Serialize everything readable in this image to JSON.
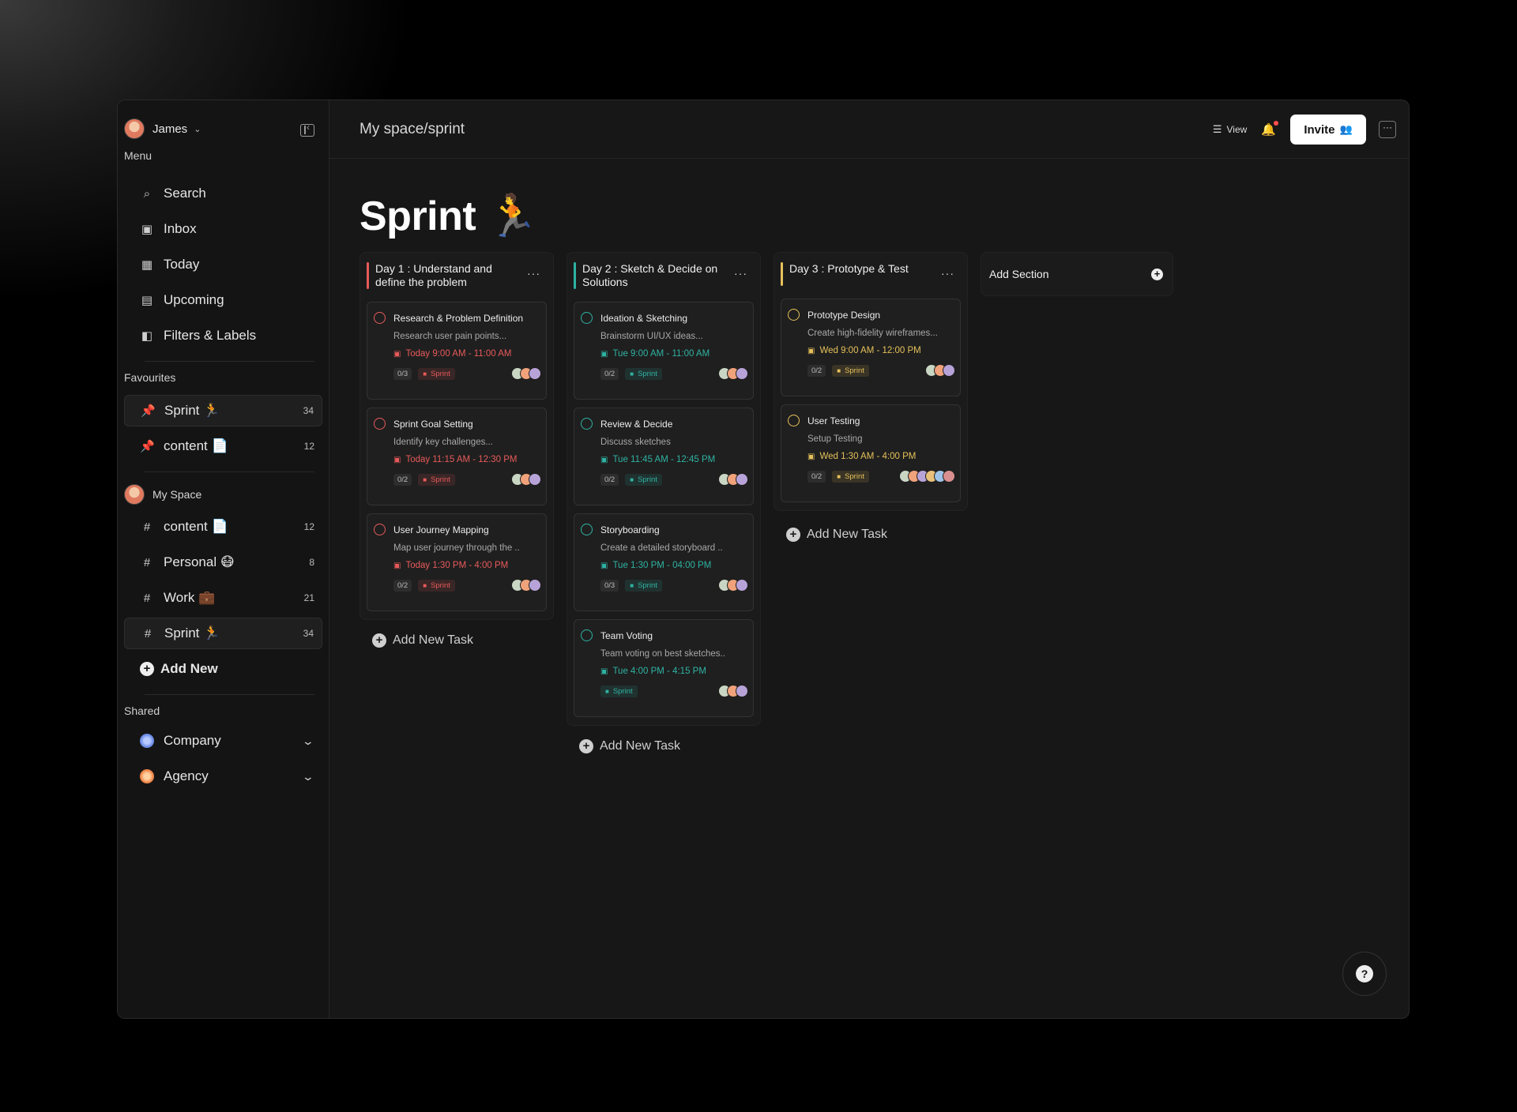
{
  "sidebar": {
    "user": "James",
    "menu_label": "Menu",
    "menu": [
      {
        "label": "Search",
        "icon": "search-icon"
      },
      {
        "label": "Inbox",
        "icon": "inbox-icon"
      },
      {
        "label": "Today",
        "icon": "calendar-icon"
      },
      {
        "label": "Upcoming",
        "icon": "upcoming-calendar-icon"
      },
      {
        "label": "Filters & Labels",
        "icon": "tag-icon"
      }
    ],
    "favourites_label": "Favourites",
    "favourites": [
      {
        "label": "Sprint 🏃",
        "count": "34"
      },
      {
        "label": "content 📄",
        "count": "12"
      }
    ],
    "space_label": "My Space",
    "space_items": [
      {
        "label": "content 📄",
        "count": "12"
      },
      {
        "label": "Personal 😷",
        "count": "8"
      },
      {
        "label": "Work 💼",
        "count": "21"
      },
      {
        "label": "Sprint 🏃",
        "count": "34"
      }
    ],
    "add_new": "Add New",
    "shared_label": "Shared",
    "shared": [
      {
        "label": "Company"
      },
      {
        "label": "Agency"
      }
    ]
  },
  "header": {
    "breadcrumb": "My space/sprint",
    "view": "View",
    "invite": "Invite"
  },
  "page_title": "Sprint 🏃",
  "columns": [
    {
      "title": "Day 1 : Understand and define the problem",
      "accent": "#e85a5a",
      "cards": [
        {
          "title": "Research & Problem Definition",
          "desc": "Research user pain points...",
          "time": "Today 9:00 AM - 11:00 AM",
          "count": "0/3",
          "tag": "Sprint"
        },
        {
          "title": "Sprint Goal Setting",
          "desc": "Identify key challenges...",
          "time": "Today 11:15 AM - 12:30 PM",
          "count": "0/2",
          "tag": "Sprint"
        },
        {
          "title": "User Journey Mapping",
          "desc": "Map user journey through the ..",
          "time": "Today 1:30 PM - 4:00 PM",
          "count": "0/2",
          "tag": "Sprint"
        }
      ],
      "add_task": "Add New Task"
    },
    {
      "title": "Day 2 : Sketch & Decide on Solutions",
      "accent": "#2fb3a3",
      "cards": [
        {
          "title": "Ideation & Sketching",
          "desc": "Brainstorm UI/UX ideas...",
          "time": "Tue 9:00 AM - 11:00 AM",
          "count": "0/2",
          "tag": "Sprint"
        },
        {
          "title": "Review & Decide",
          "desc": "Discuss sketches",
          "time": "Tue 11:45 AM - 12:45 PM",
          "count": "0/2",
          "tag": "Sprint"
        },
        {
          "title": "Storyboarding",
          "desc": "Create a detailed storyboard ..",
          "time": "Tue 1:30 PM - 04:00 PM",
          "count": "0/3",
          "tag": "Sprint"
        },
        {
          "title": "Team Voting",
          "desc": "Team voting on best sketches..",
          "time": "Tue 4:00 PM - 4:15 PM",
          "count": "",
          "tag": "Sprint"
        }
      ],
      "add_task": "Add New Task"
    },
    {
      "title": "Day 3 : Prototype & Test",
      "accent": "#e5c15a",
      "cards": [
        {
          "title": "Prototype Design",
          "desc": "Create high-fidelity wireframes...",
          "time": "Wed 9:00 AM - 12:00 PM",
          "count": "0/2",
          "tag": "Sprint"
        },
        {
          "title": "User Testing",
          "desc": "Setup Testing",
          "time": "Wed 1:30 AM - 4:00 PM",
          "count": "0/2",
          "tag": "Sprint"
        }
      ],
      "add_task": "Add New Task"
    }
  ],
  "add_section": "Add Section",
  "colors": {
    "red": "#e85a5a",
    "teal": "#2fb3a3",
    "yellow": "#e5c15a"
  }
}
